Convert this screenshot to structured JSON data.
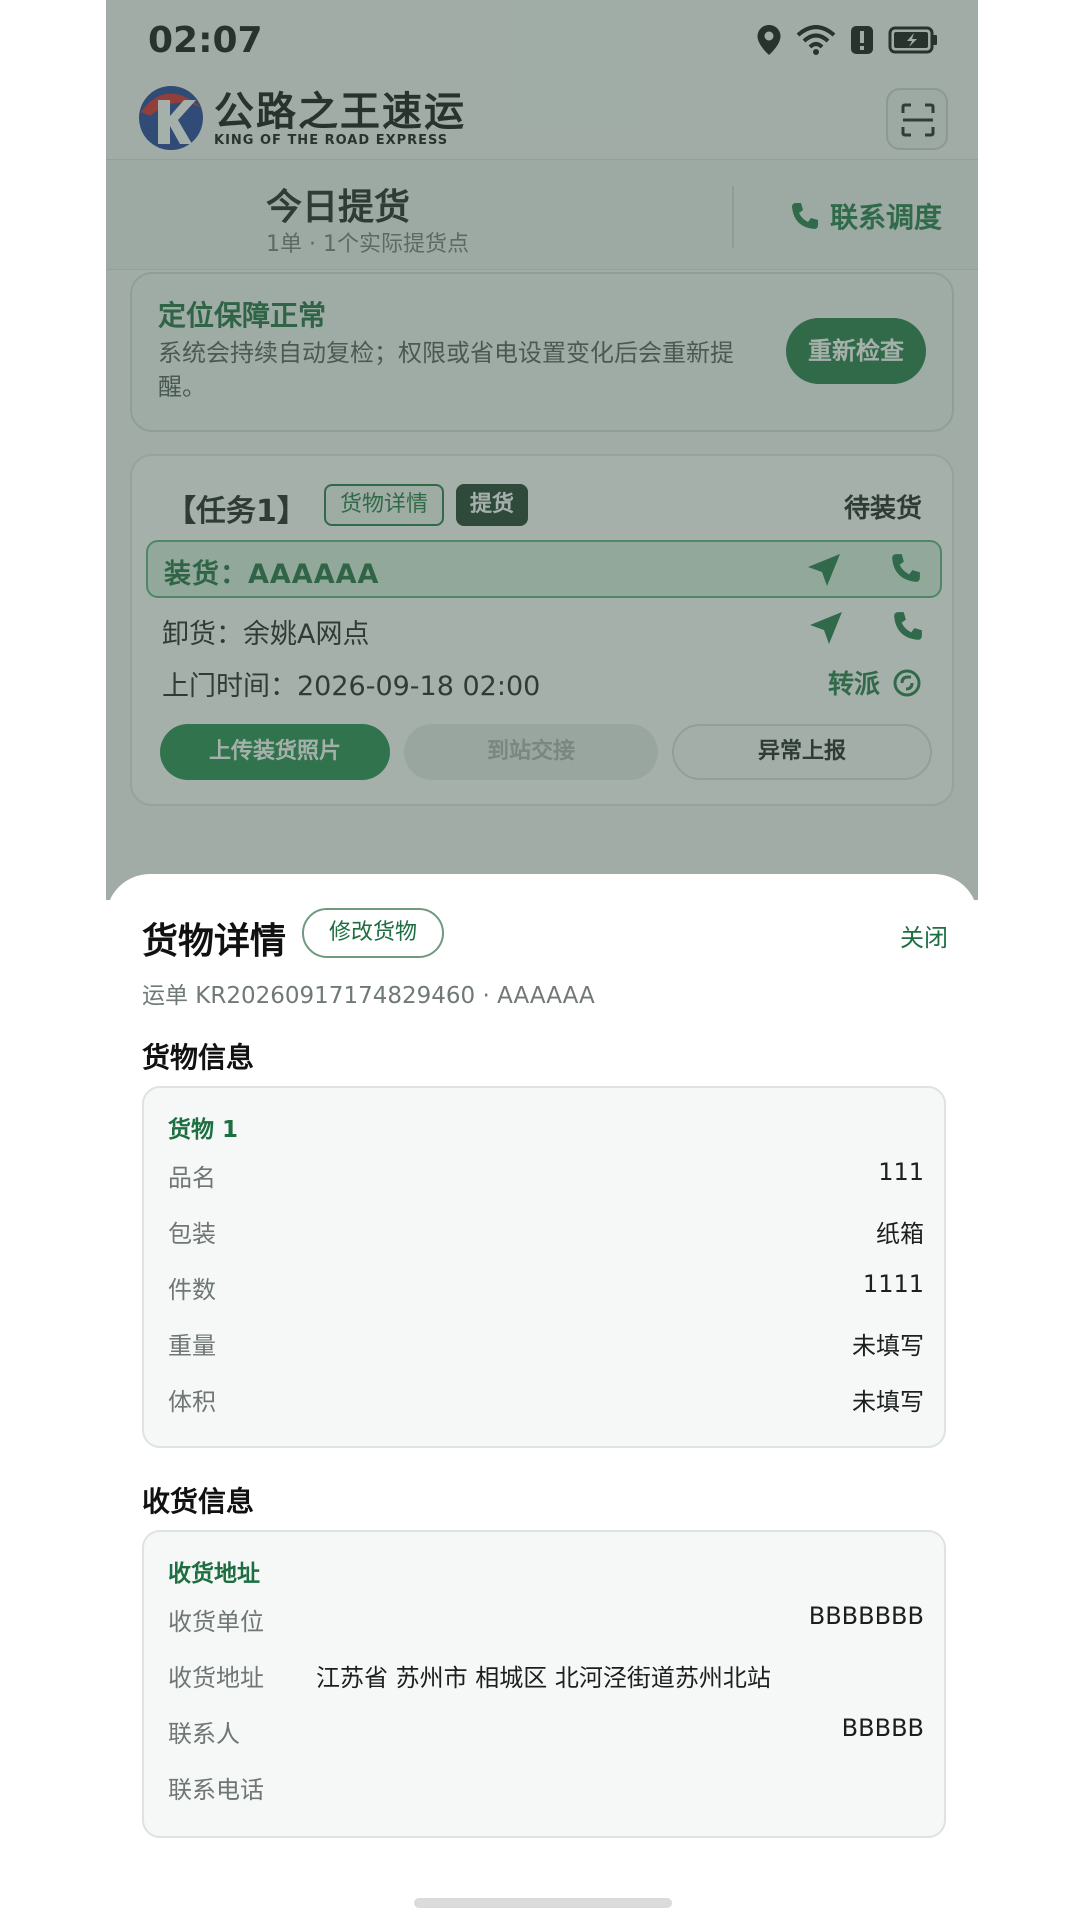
{
  "status_bar": {
    "time": "02:07"
  },
  "header": {
    "logo_cn": "公路之王速运",
    "logo_en": "KING OF THE ROAD EXPRESS"
  },
  "today": {
    "title": "今日提货",
    "subtitle": "1单 · 1个实际提货点",
    "contact_label": "联系调度"
  },
  "location_card": {
    "title": "定位保障正常",
    "description": "系统会持续自动复检；权限或省电设置变化后会重新提醒。",
    "recheck_label": "重新检查"
  },
  "task": {
    "title": "【任务1】",
    "tag_detail": "货物详情",
    "tag_pickup": "提货",
    "status": "待装货",
    "load": "装货：AAAAAA",
    "unload": "卸货：余姚A网点",
    "visit_time": "上门时间：2026-09-18 02:00",
    "transfer_label": "转派",
    "btn_upload": "上传装货照片",
    "btn_arrive": "到站交接",
    "btn_abnormal": "异常上报"
  },
  "sheet": {
    "title": "货物详情",
    "edit_label": "修改货物",
    "close_label": "关闭",
    "waybill": "运单 KR20260917174829460 · AAAAAA",
    "cargo_section": "货物信息",
    "cargo": {
      "heading": "货物 1",
      "rows": [
        {
          "key": "品名",
          "value": "111"
        },
        {
          "key": "包装",
          "value": "纸箱"
        },
        {
          "key": "件数",
          "value": "1111"
        },
        {
          "key": "重量",
          "value": "未填写"
        },
        {
          "key": "体积",
          "value": "未填写"
        }
      ]
    },
    "receiver_section": "收货信息",
    "receiver": {
      "heading": "收货地址",
      "rows": [
        {
          "key": "收货单位",
          "value": "BBBBBBB"
        },
        {
          "key": "收货地址",
          "value": "江苏省 苏州市 相城区 北河泾街道苏州北站"
        },
        {
          "key": "联系人",
          "value": "BBBBB"
        },
        {
          "key": "联系电话",
          "value": ""
        }
      ]
    }
  },
  "colors": {
    "brand_green": "#1e7a43",
    "dark_tag": "#1b3a2a",
    "overlay": "rgba(70,90,80,0.48)"
  }
}
